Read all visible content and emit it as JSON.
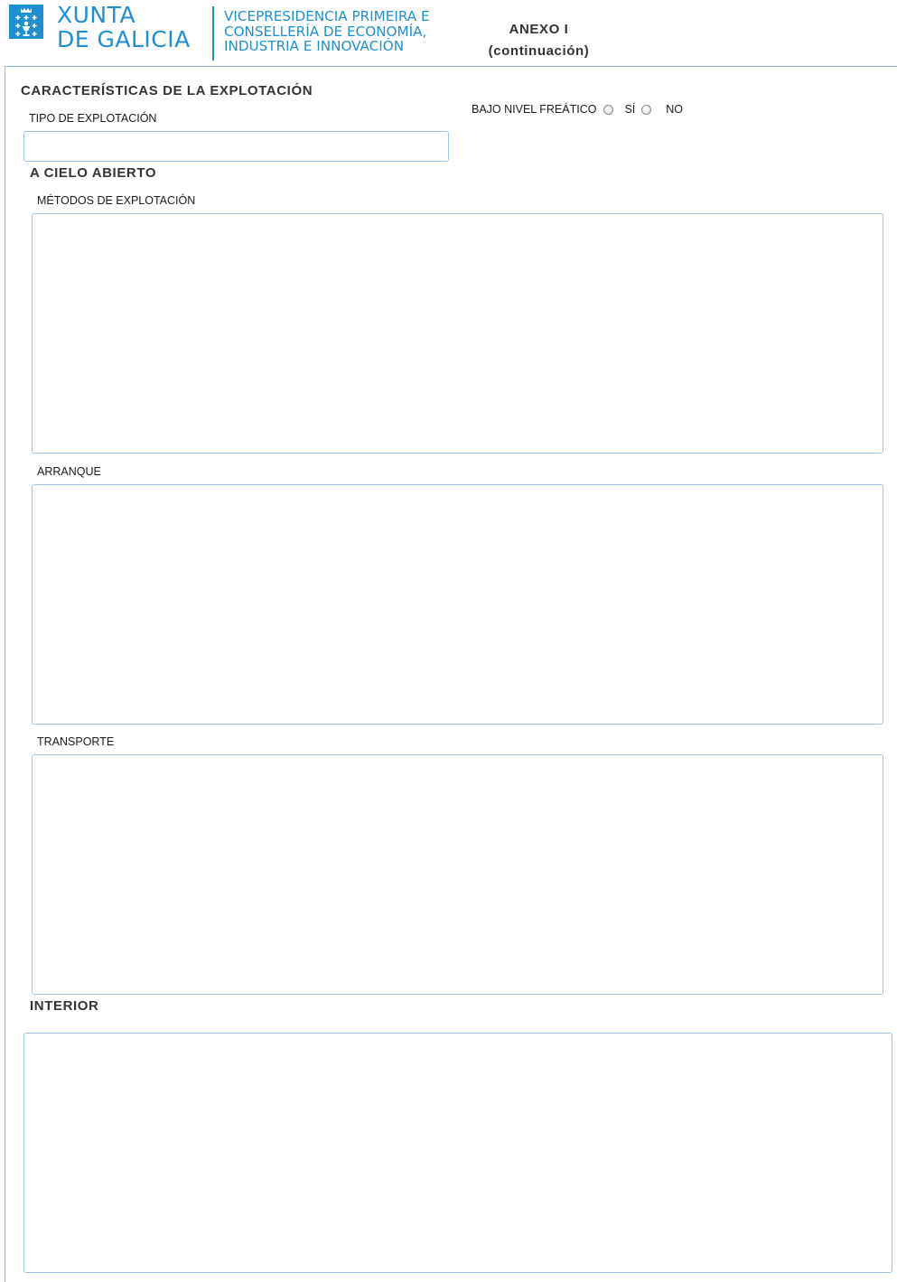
{
  "header": {
    "logo_line1": "XUNTA",
    "logo_line2": "DE GALICIA",
    "dept_line1": "VICEPRESIDENCIA PRIMEIRA E",
    "dept_line2": "CONSELLERÍA DE ECONOMÍA,",
    "dept_line3": "INDUSTRIA E INNOVACIÓN",
    "annex_title": "ANEXO I",
    "annex_subtitle": "(continuación)",
    "brand_color": "#1f8fd1"
  },
  "form": {
    "section_title": "CARACTERÍSTICAS DE LA EXPLOTACIÓN",
    "tipo_label": "TIPO DE EXPLOTACIÓN",
    "tipo_value": "",
    "freatico": {
      "label": "BAJO NIVEL FREÁTICO",
      "option_yes": "SÍ",
      "option_no": "NO",
      "selected": null
    },
    "cielo_abierto": {
      "title": "A CIELO ABIERTO",
      "metodos_label": "MÉTODOS DE EXPLOTACIÓN",
      "metodos_value": "",
      "arranque_label": "ARRANQUE",
      "arranque_value": "",
      "transporte_label": "TRANSPORTE",
      "transporte_value": ""
    },
    "interior": {
      "title": "INTERIOR",
      "value": ""
    }
  }
}
